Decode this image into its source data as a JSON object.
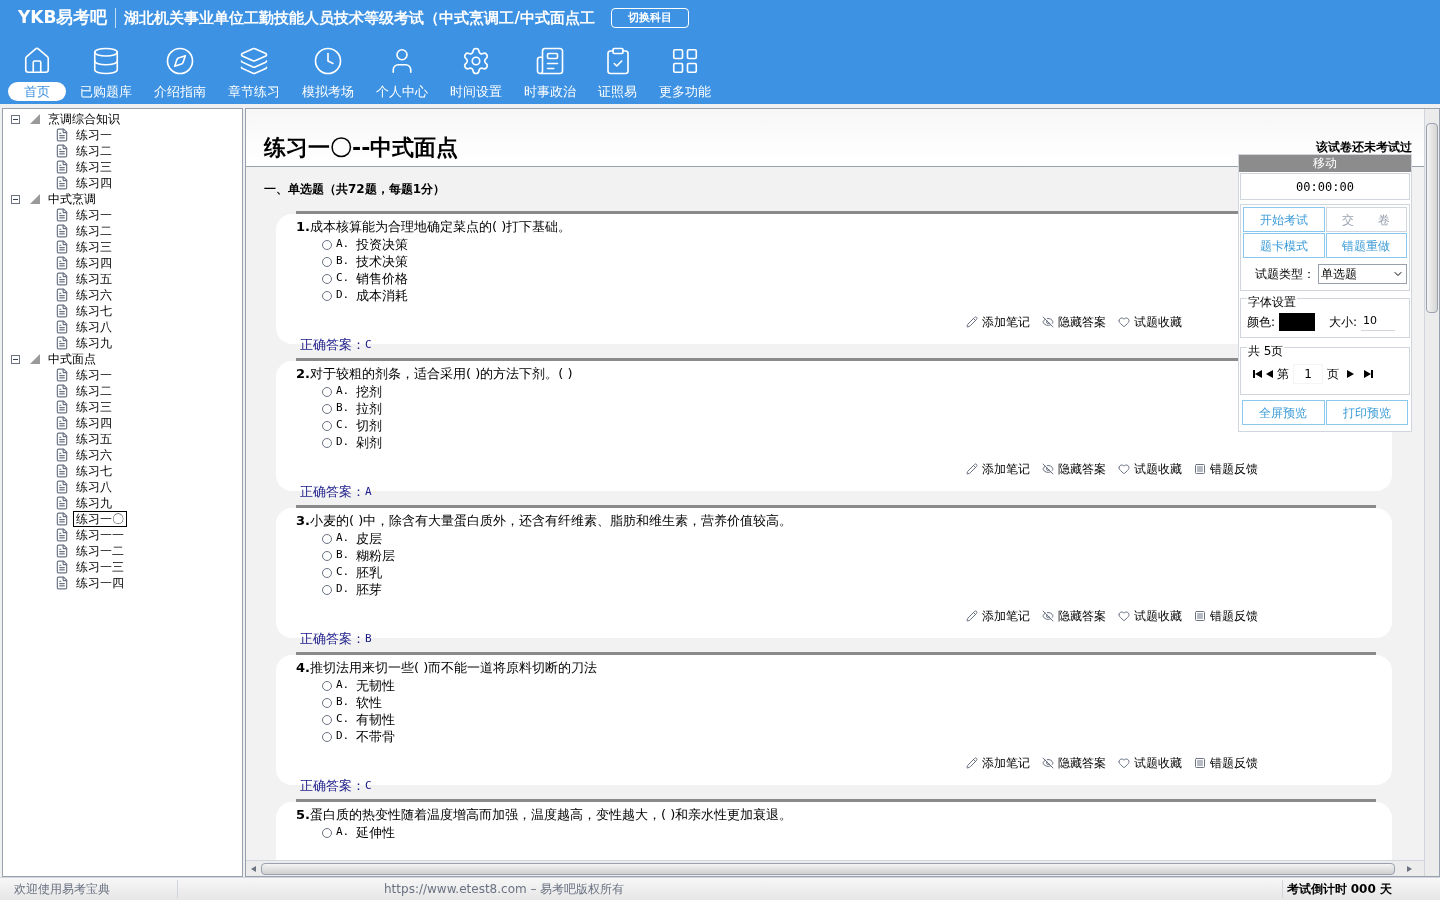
{
  "app": {
    "logo": "YKB易考吧",
    "title": "湖北机关事业单位工勤技能人员技术等级考试（中式烹调工/中式面点工",
    "switch_button": "切换科目"
  },
  "nav": [
    {
      "label": "首页",
      "selected": true
    },
    {
      "label": "已购题库",
      "selected": false
    },
    {
      "label": "介绍指南",
      "selected": false
    },
    {
      "label": "章节练习",
      "selected": false
    },
    {
      "label": "模拟考场",
      "selected": false
    },
    {
      "label": "个人中心",
      "selected": false
    },
    {
      "label": "时间设置",
      "selected": false
    },
    {
      "label": "时事政治",
      "selected": false
    },
    {
      "label": "证照易",
      "selected": false
    },
    {
      "label": "更多功能",
      "selected": false
    }
  ],
  "tree": [
    {
      "label": "烹调综合知识",
      "expanded": true,
      "children": [
        {
          "label": "练习一",
          "selected": false
        },
        {
          "label": "练习二",
          "selected": false
        },
        {
          "label": "练习三",
          "selected": false
        },
        {
          "label": "练习四",
          "selected": false
        }
      ]
    },
    {
      "label": "中式烹调",
      "expanded": true,
      "children": [
        {
          "label": "练习一",
          "selected": false
        },
        {
          "label": "练习二",
          "selected": false
        },
        {
          "label": "练习三",
          "selected": false
        },
        {
          "label": "练习四",
          "selected": false
        },
        {
          "label": "练习五",
          "selected": false
        },
        {
          "label": "练习六",
          "selected": false
        },
        {
          "label": "练习七",
          "selected": false
        },
        {
          "label": "练习八",
          "selected": false
        },
        {
          "label": "练习九",
          "selected": false
        }
      ]
    },
    {
      "label": "中式面点",
      "expanded": true,
      "children": [
        {
          "label": "练习一",
          "selected": false
        },
        {
          "label": "练习二",
          "selected": false
        },
        {
          "label": "练习三",
          "selected": false
        },
        {
          "label": "练习四",
          "selected": false
        },
        {
          "label": "练习五",
          "selected": false
        },
        {
          "label": "练习六",
          "selected": false
        },
        {
          "label": "练习七",
          "selected": false
        },
        {
          "label": "练习八",
          "selected": false
        },
        {
          "label": "练习九",
          "selected": false
        },
        {
          "label": "练习一〇",
          "selected": true
        },
        {
          "label": "练习一一",
          "selected": false
        },
        {
          "label": "练习一二",
          "selected": false
        },
        {
          "label": "练习一三",
          "selected": false
        },
        {
          "label": "练习一四",
          "selected": false
        }
      ]
    }
  ],
  "paper": {
    "title": "练习一〇--中式面点",
    "status": "该试卷还未考试过",
    "section": "一、单选题（共72题，每题1分）"
  },
  "questions": [
    {
      "number": "1.",
      "text": "成本核算能为合理地确定菜点的(  )打下基础。",
      "options": [
        {
          "label": "A.",
          "text": "投资决策",
          "selected": false
        },
        {
          "label": "B.",
          "text": "技术决策",
          "selected": false
        },
        {
          "label": "C.",
          "text": "销售价格",
          "selected": false
        },
        {
          "label": "D.",
          "text": "成本消耗",
          "selected": false
        }
      ],
      "actions": [
        "添加笔记",
        "隐藏答案",
        "试题收藏"
      ],
      "answer_label": "正确答案：",
      "answer": "C"
    },
    {
      "number": "2.",
      "text": "对于较粗的剂条，适合采用(  )的方法下剂。( )",
      "options": [
        {
          "label": "A.",
          "text": "挖剂",
          "selected": false
        },
        {
          "label": "B.",
          "text": "拉剂",
          "selected": false
        },
        {
          "label": "C.",
          "text": "切剂",
          "selected": false
        },
        {
          "label": "D.",
          "text": "剁剂",
          "selected": false
        }
      ],
      "actions": [
        "添加笔记",
        "隐藏答案",
        "试题收藏",
        "错题反馈"
      ],
      "answer_label": "正确答案：",
      "answer": "A"
    },
    {
      "number": "3.",
      "text": "小麦的(  )中，除含有大量蛋白质外，还含有纤维素、脂肪和维生素，营养价值较高。",
      "options": [
        {
          "label": "A.",
          "text": "皮层",
          "selected": false
        },
        {
          "label": "B.",
          "text": "糊粉层",
          "selected": false
        },
        {
          "label": "C.",
          "text": "胚乳",
          "selected": false
        },
        {
          "label": "D.",
          "text": "胚芽",
          "selected": false
        }
      ],
      "actions": [
        "添加笔记",
        "隐藏答案",
        "试题收藏",
        "错题反馈"
      ],
      "answer_label": "正确答案：",
      "answer": "B"
    },
    {
      "number": "4.",
      "text": "推切法用来切一些(  )而不能一道将原料切断的刀法",
      "options": [
        {
          "label": "A.",
          "text": "无韧性",
          "selected": false
        },
        {
          "label": "B.",
          "text": "软性",
          "selected": false
        },
        {
          "label": "C.",
          "text": "有韧性",
          "selected": false
        },
        {
          "label": "D.",
          "text": "不带骨",
          "selected": false
        }
      ],
      "actions": [
        "添加笔记",
        "隐藏答案",
        "试题收藏",
        "错题反馈"
      ],
      "answer_label": "正确答案：",
      "answer": "C"
    },
    {
      "number": "5.",
      "text": "蛋白质的热变性随着温度增高而加强，温度越高，变性越大，(  )和亲水性更加衰退。",
      "options": [
        {
          "label": "A.",
          "text": "延伸性",
          "selected": false
        }
      ]
    }
  ],
  "panel": {
    "handle": "移动",
    "timer": "00:00:00",
    "buttons": [
      {
        "label": "开始考试",
        "disabled": false
      },
      {
        "label": "交　　卷",
        "disabled": true
      },
      {
        "label": "题卡模式",
        "disabled": false
      },
      {
        "label": "错题重做",
        "disabled": false
      }
    ],
    "type_label": "试题类型：",
    "type_value": "单选题",
    "font_title": "字体设置",
    "color_label": "颜色:",
    "size_label": "大小:",
    "size_value": "10",
    "pages_title": "共 5页",
    "page_prefix": "第",
    "page_value": "1",
    "page_suffix": "页",
    "preview_buttons": [
      "全屏预览",
      "打印预览"
    ]
  },
  "status_bar": {
    "welcome": "欢迎使用易考宝典",
    "copyright": "https://www.etest8.com – 易考吧版权所有",
    "countdown": "考试倒计时 000 天"
  }
}
